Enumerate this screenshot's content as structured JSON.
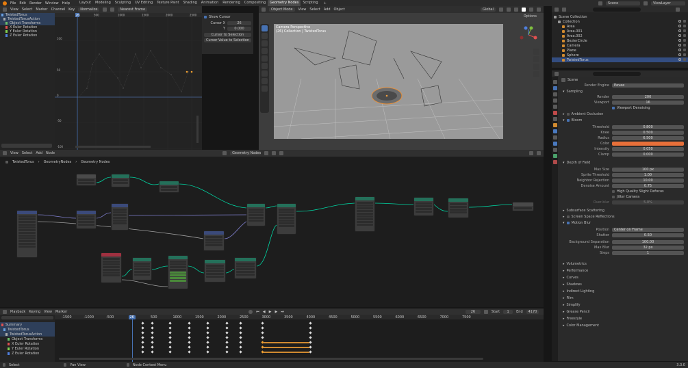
{
  "menu": [
    "File",
    "Edit",
    "Render",
    "Window",
    "Help"
  ],
  "workspaces": [
    "Layout",
    "Modeling",
    "Sculpting",
    "UV Editing",
    "Texture Paint",
    "Shading",
    "Animation",
    "Rendering",
    "Compositing",
    "Geometry Nodes",
    "Scripting"
  ],
  "active_workspace": "Geometry Nodes",
  "scene_name": "Scene",
  "view_layer": "ViewLayer",
  "graph": {
    "menu": [
      "View",
      "Select",
      "Marker",
      "Channel",
      "Key"
    ],
    "normalize": "Normalize",
    "frame_mode": "Nearest Frame",
    "channels": [
      {
        "label": "TwistedTorus",
        "color": "#6aa0e0"
      },
      {
        "label": "TwistedTorusAction",
        "color": "#aaaaaa"
      },
      {
        "label": "Object Transforms",
        "color": "#6ac06a"
      },
      {
        "label": "X Euler Rotation",
        "color": "#e05050"
      },
      {
        "label": "Y Euler Rotation",
        "color": "#80d050"
      },
      {
        "label": "Z Euler Rotation",
        "color": "#5080e0"
      }
    ],
    "frame_ticks": [
      "26",
      "500",
      "1000",
      "1500",
      "2000",
      "2500"
    ],
    "value_ticks": [
      "100",
      "50",
      "0",
      "-50",
      "-100"
    ],
    "cursor_x_label": "Cursor X",
    "cursor_x": "26",
    "cursor_y_label": "Y",
    "cursor_y": "0.000",
    "show_cursor": "Show Cursor",
    "cursor_to_selection": "Cursor to Selection",
    "cursor_value_to_selection": "Cursor Value to Selection"
  },
  "viewport": {
    "mode": "Object Mode",
    "menu": [
      "View",
      "Select",
      "Add",
      "Object"
    ],
    "orientation": "Global",
    "options": "Options",
    "info_line1": "Camera Perspective",
    "info_line2": "(26) Collection | TwistedTorus"
  },
  "outliner": {
    "search_placeholder": "",
    "items": [
      {
        "label": "Scene Collection",
        "level": 0
      },
      {
        "label": "Collection",
        "level": 1
      },
      {
        "label": "Area",
        "level": 2
      },
      {
        "label": "Area.001",
        "level": 2
      },
      {
        "label": "Area.002",
        "level": 2
      },
      {
        "label": "BezierCircle",
        "level": 2
      },
      {
        "label": "Camera",
        "level": 2
      },
      {
        "label": "Plane",
        "level": 2
      },
      {
        "label": "Sphere",
        "level": 2
      },
      {
        "label": "TwistedTorus",
        "level": 2
      }
    ]
  },
  "properties": {
    "scene_label": "Scene",
    "render_engine_label": "Render Engine",
    "render_engine": "Eevee",
    "sampling": "Sampling",
    "render_label": "Render",
    "render_value": "200",
    "viewport_label": "Viewport",
    "viewport_value": "16",
    "viewport_denoising": "Viewport Denoising",
    "ambient_occlusion": "Ambient Occlusion",
    "bloom": "Bloom",
    "bloom_rows": [
      {
        "label": "Threshold",
        "value": "0.800",
        "fill": 0.05
      },
      {
        "label": "Knee",
        "value": "0.500",
        "fill": 0.5
      },
      {
        "label": "Radius",
        "value": "6.500",
        "fill": 0.65
      },
      {
        "label": "Color",
        "value": "",
        "fill": 0
      },
      {
        "label": "Intensity",
        "value": "0.050",
        "fill": 0.5
      },
      {
        "label": "Clamp",
        "value": "0.000",
        "fill": 0
      }
    ],
    "bloom_color": "#e8703a",
    "dof": "Depth of Field",
    "dof_rows": [
      {
        "label": "Max Size",
        "value": "100 px",
        "fill": 0
      },
      {
        "label": "Sprite Threshold",
        "value": "1.00",
        "fill": 0.1
      },
      {
        "label": "Neighbor Rejection",
        "value": "10.00",
        "fill": 0.1
      },
      {
        "label": "Denoise Amount",
        "value": "0.75",
        "fill": 0.75
      }
    ],
    "high_quality_defocus": "High Quality Slight Defocus",
    "jitter_camera": "Jitter Camera",
    "overblur_label": "Over-blur",
    "overblur_value": "5.0%",
    "subsurface": "Subsurface Scattering",
    "ssr": "Screen Space Reflections",
    "motion_blur": "Motion Blur",
    "position_label": "Position",
    "position_value": "Center on Frame",
    "shutter_label": "Shutter",
    "shutter_value": "0.50",
    "bg_sep_label": "Background Separation",
    "bg_sep_value": "100.00",
    "max_blur_label": "Max Blur",
    "max_blur_value": "32 px",
    "steps_label": "Steps",
    "steps_value": "1",
    "collapsed": [
      "Volumetrics",
      "Performance",
      "Curves",
      "Shadows",
      "Indirect Lighting",
      "Film",
      "Simplify",
      "Grease Pencil",
      "Freestyle",
      "Color Management"
    ]
  },
  "node_editor": {
    "menu": [
      "View",
      "Select",
      "Add",
      "Node"
    ],
    "editor_type": "Geometry Nodes",
    "breadcrumb": [
      "TwistedTorus",
      "GeometryNodes",
      "Geometry Nodes"
    ]
  },
  "dopesheet": {
    "playback": "Playback",
    "keying": "Keying",
    "menu": [
      "View",
      "Marker"
    ],
    "current_frame": "26",
    "start_label": "Start",
    "start": "1",
    "end_label": "End",
    "end": "4170",
    "ruler": [
      "-1500",
      "-1000",
      "-500",
      "26",
      "500",
      "1000",
      "1500",
      "2000",
      "2500",
      "3000",
      "3500",
      "4000",
      "4500",
      "5000",
      "5500",
      "6000",
      "6500",
      "7000",
      "7500"
    ],
    "channels": [
      {
        "label": "Summary",
        "color": "#e05050"
      },
      {
        "label": "TwistedTorus",
        "color": "#6aa0e0"
      },
      {
        "label": "TwistedTorusAction",
        "color": "#aaaaaa"
      },
      {
        "label": "Object Transforms",
        "color": "#6ac06a"
      },
      {
        "label": "X Euler Rotation",
        "color": "#e05050"
      },
      {
        "label": "Y Euler Rotation",
        "color": "#80d050"
      },
      {
        "label": "Z Euler Rotation",
        "color": "#5080e0"
      }
    ]
  },
  "status": {
    "select": "Select",
    "pan": "Pan View",
    "context": "Node Context Menu",
    "version": "3.3.0"
  }
}
